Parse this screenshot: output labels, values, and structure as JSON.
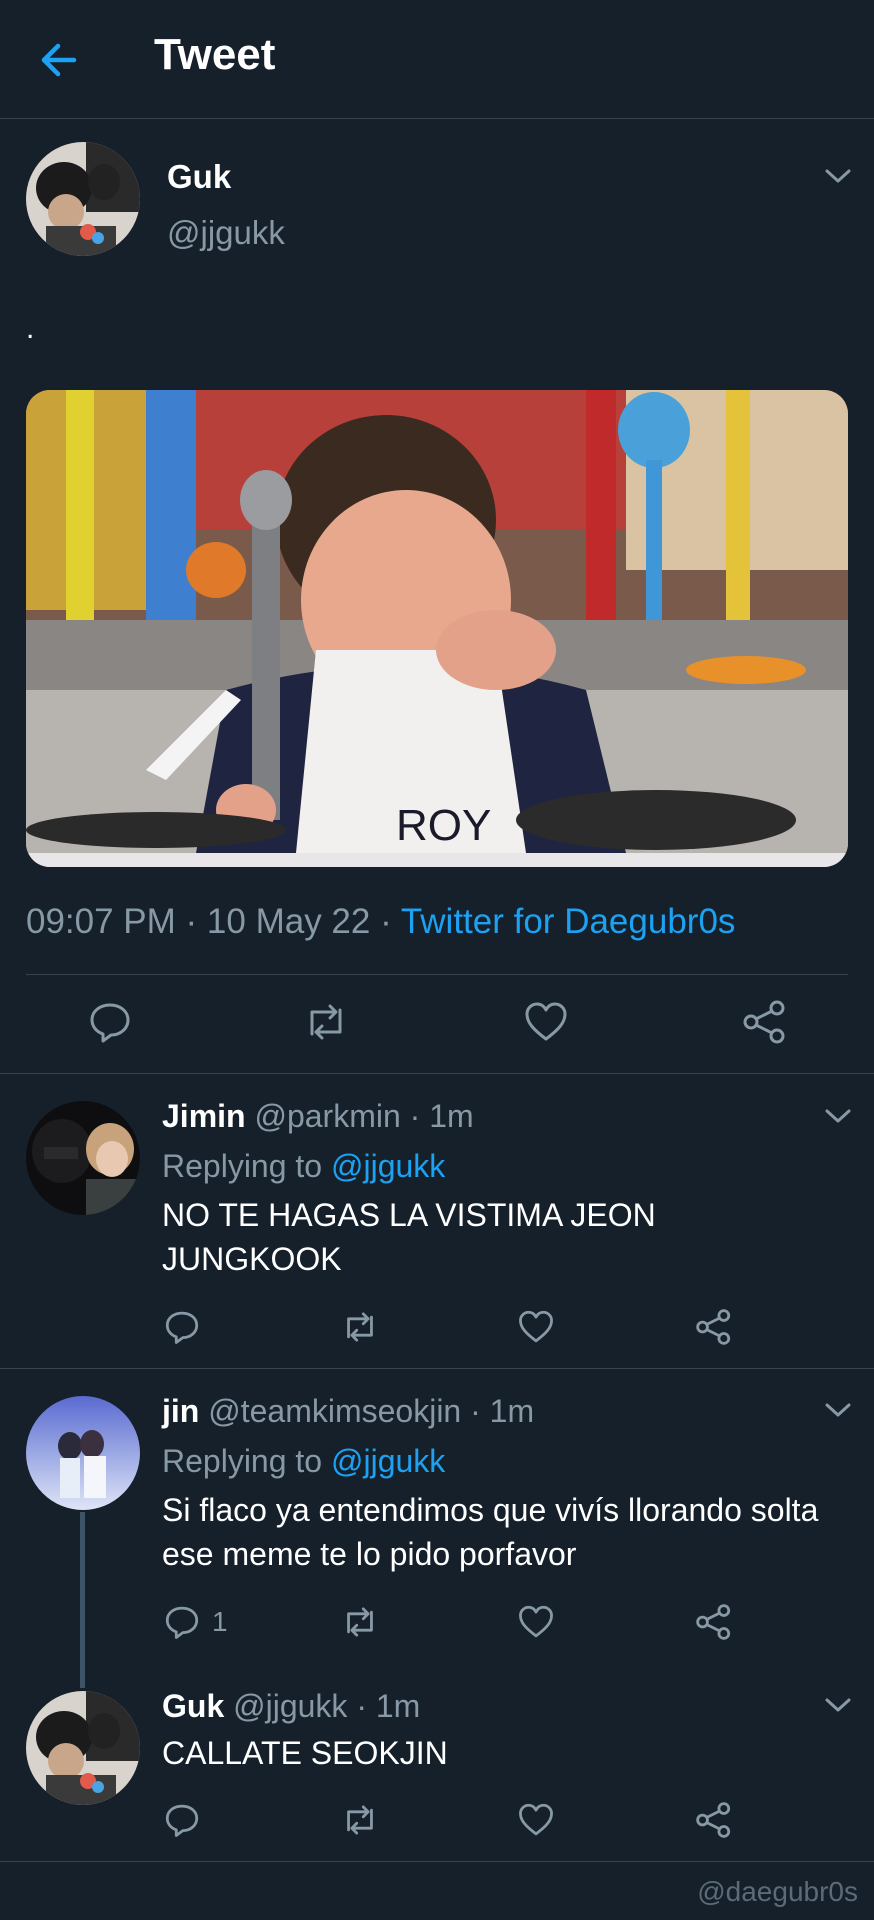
{
  "header": {
    "title": "Tweet",
    "back_icon": "arrow-left-icon"
  },
  "colors": {
    "background": "#15202b",
    "accent": "#1da1f2",
    "muted": "#8899a6",
    "border": "#38444d"
  },
  "main_tweet": {
    "name": "Guk",
    "handle": "@jjgukk",
    "text": ".",
    "image": {
      "alt": "crying boy in kitchen meme",
      "apron_text": "ROY"
    },
    "time": "09:07 PM · 10 May 22 · ",
    "source": "Twitter for Daegubr0s",
    "actions": [
      "reply-icon",
      "retweet-icon",
      "like-icon",
      "share-icon"
    ]
  },
  "replies": [
    {
      "name": "Jimin",
      "meta": " @parkmin · 1m",
      "replying_prefix": "Replying to ",
      "replying_to": "@jjgukk",
      "text": "NO TE HAGAS LA VISTIMA JEON JUNGKOOK",
      "reply_count": ""
    },
    {
      "name": "jin",
      "meta": " @teamkimseokjin · 1m",
      "replying_prefix": "Replying to ",
      "replying_to": "@jjgukk",
      "text": "Si flaco ya entendimos que vivís llorando solta ese meme te lo pido porfavor",
      "reply_count": "1"
    },
    {
      "name": "Guk",
      "meta": " @jjgukk · 1m",
      "text": "CALLATE SEOKJIN",
      "reply_count": ""
    }
  ],
  "watermark": "@daegubr0s"
}
